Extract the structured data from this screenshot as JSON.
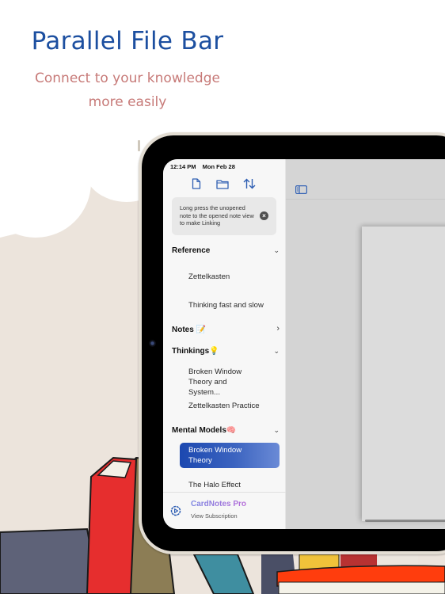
{
  "promo": {
    "title": "Parallel File Bar",
    "subtitle_line1": "Connect to your knowledge",
    "subtitle_line2": "more easily"
  },
  "colors": {
    "title": "#1c4fa0",
    "subtitle": "#c77a78",
    "accent": "#1c48b0",
    "pro_gradient_start": "#7b86e2",
    "pro_gradient_end": "#b66bd8"
  },
  "status_bar": {
    "time": "12:14 PM",
    "date": "Mon Feb 28"
  },
  "toolbar": {
    "icons": [
      "new-note-icon",
      "folder-icon",
      "sort-icon"
    ]
  },
  "tip": {
    "text": "Long press the unopened note to the opened note view to make Linking",
    "close_icon": "close-circle-icon"
  },
  "sidebar": {
    "groups": [
      {
        "label": "Reference",
        "expanded": true,
        "items": [
          "Zettelkasten",
          "Thinking fast and slow"
        ]
      },
      {
        "label": "Notes 📝",
        "expanded": false,
        "items": []
      },
      {
        "label": "Thinkings💡",
        "expanded": true,
        "items": [
          "Broken Window Theory and System...",
          "Zettelkasten Practice"
        ]
      },
      {
        "label": "Mental Models🧠",
        "expanded": true,
        "items": [
          "Broken Window Theory",
          "The Halo Effect"
        ],
        "selected": "Broken Window Theory"
      }
    ],
    "chevron_expanded": "⌄",
    "chevron_collapsed": "›"
  },
  "subscription": {
    "title": "CardNotes Pro",
    "subtitle": "View Subscription"
  },
  "main": {
    "more_dots": "••"
  }
}
